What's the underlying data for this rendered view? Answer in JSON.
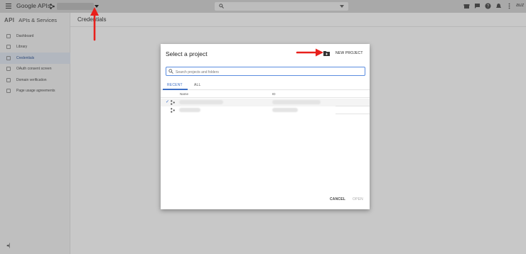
{
  "topbar": {
    "brand": "Google APIs",
    "icons": [
      "menu-icon",
      "project-icon",
      "search-icon",
      "gift-icon",
      "chat-icon",
      "help-icon",
      "notifications-icon",
      "more-vert-icon"
    ],
    "avatar": "auz"
  },
  "sidebar": {
    "logo": "API",
    "title": "APIs & Services",
    "items": [
      {
        "label": "Dashboard",
        "icon": "dashboard-icon"
      },
      {
        "label": "Library",
        "icon": "library-icon"
      },
      {
        "label": "Credentials",
        "icon": "key-icon",
        "active": true
      },
      {
        "label": "OAuth consent screen",
        "icon": "consent-icon"
      },
      {
        "label": "Domain verification",
        "icon": "domain-check-icon"
      },
      {
        "label": "Page usage agreements",
        "icon": "settings-list-icon"
      }
    ],
    "collapse_label": "◂|"
  },
  "content": {
    "title": "Credentials"
  },
  "dialog": {
    "title": "Select a project",
    "new_project": "NEW PROJECT",
    "search_placeholder": "Search projects and folders",
    "tabs": [
      "RECENT",
      "ALL"
    ],
    "active_tab": "RECENT",
    "columns": [
      "Name",
      "ID"
    ],
    "rows": [
      {
        "selected": true
      },
      {
        "selected": false
      }
    ],
    "cancel": "CANCEL",
    "open": "OPEN",
    "accent": "#3d6fc6"
  },
  "annotation_color": "#e8201c"
}
